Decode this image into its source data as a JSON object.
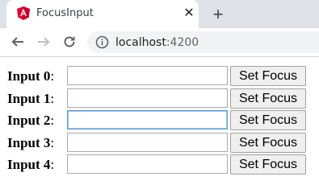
{
  "browser": {
    "tab_title": "FocusInput",
    "close_glyph": "✕",
    "new_tab_glyph": "+",
    "url_host": "localhost",
    "url_port": ":4200"
  },
  "rows": [
    {
      "label": "Input 0",
      "value": "",
      "button": "Set Focus"
    },
    {
      "label": "Input 1",
      "value": "",
      "button": "Set Focus"
    },
    {
      "label": "Input 2",
      "value": "",
      "button": "Set Focus"
    },
    {
      "label": "Input 3",
      "value": "",
      "button": "Set Focus"
    },
    {
      "label": "Input 4",
      "value": "",
      "button": "Set Focus"
    }
  ],
  "focused_index": 2,
  "colors": {
    "angular_red": "#dd0031",
    "focus_border": "#5b9ad4"
  },
  "icons": {
    "favicon": "angular-logo-icon",
    "back": "arrow-left-icon",
    "forward": "arrow-right-icon",
    "reload": "reload-icon",
    "info": "info-circle-icon"
  }
}
